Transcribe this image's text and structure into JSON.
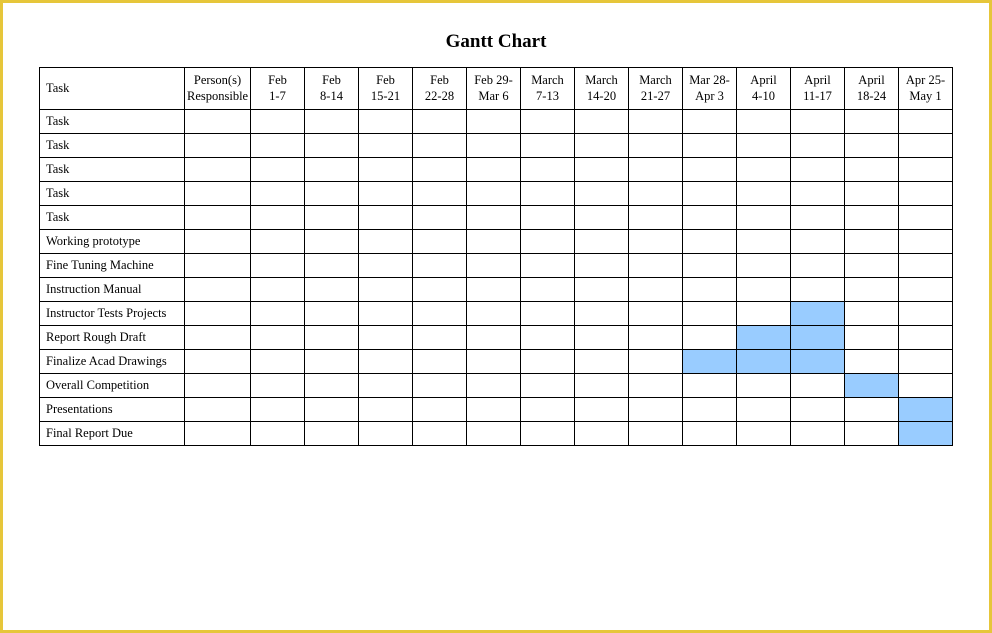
{
  "title": "Gantt Chart",
  "columns": {
    "task": "Task",
    "person": "Person(s) Responsible",
    "dates": [
      "Feb\n1-7",
      "Feb\n8-14",
      "Feb\n15-21",
      "Feb\n22-28",
      "Feb 29-\nMar 6",
      "March\n7-13",
      "March\n14-20",
      "March\n21-27",
      "Mar 28-\nApr 3",
      "April\n4-10",
      "April\n11-17",
      "April\n18-24",
      "Apr 25-\nMay 1"
    ]
  },
  "tasks": [
    {
      "name": "Task",
      "person": "",
      "bars": []
    },
    {
      "name": "Task",
      "person": "",
      "bars": []
    },
    {
      "name": "Task",
      "person": "",
      "bars": []
    },
    {
      "name": "Task",
      "person": "",
      "bars": []
    },
    {
      "name": "Task",
      "person": "",
      "bars": []
    },
    {
      "name": "Working prototype",
      "person": "",
      "bars": []
    },
    {
      "name": "Fine Tuning Machine",
      "person": "",
      "bars": []
    },
    {
      "name": "Instruction Manual",
      "person": "",
      "bars": []
    },
    {
      "name": "Instructor Tests Projects",
      "person": "",
      "bars": [
        10
      ]
    },
    {
      "name": "Report Rough Draft",
      "person": "",
      "bars": [
        9,
        10
      ]
    },
    {
      "name": "Finalize Acad Drawings",
      "person": "",
      "bars": [
        8,
        9,
        10
      ]
    },
    {
      "name": "Overall Competition",
      "person": "",
      "bars": [
        11
      ]
    },
    {
      "name": "Presentations",
      "person": "",
      "bars": [
        12
      ]
    },
    {
      "name": "Final Report Due",
      "person": "",
      "bars": [
        12
      ]
    }
  ],
  "watermark": "",
  "chart_data": {
    "type": "bar",
    "title": "Gantt Chart",
    "xlabel": "",
    "ylabel": "",
    "categories": [
      "Feb 1-7",
      "Feb 8-14",
      "Feb 15-21",
      "Feb 22-28",
      "Feb 29-Mar 6",
      "March 7-13",
      "March 14-20",
      "March 21-27",
      "Mar 28-Apr 3",
      "April 4-10",
      "April 11-17",
      "April 18-24",
      "Apr 25-May 1"
    ],
    "series": [
      {
        "name": "Task",
        "values": [
          0,
          0,
          0,
          0,
          0,
          0,
          0,
          0,
          0,
          0,
          0,
          0,
          0
        ]
      },
      {
        "name": "Task",
        "values": [
          0,
          0,
          0,
          0,
          0,
          0,
          0,
          0,
          0,
          0,
          0,
          0,
          0
        ]
      },
      {
        "name": "Task",
        "values": [
          0,
          0,
          0,
          0,
          0,
          0,
          0,
          0,
          0,
          0,
          0,
          0,
          0
        ]
      },
      {
        "name": "Task",
        "values": [
          0,
          0,
          0,
          0,
          0,
          0,
          0,
          0,
          0,
          0,
          0,
          0,
          0
        ]
      },
      {
        "name": "Task",
        "values": [
          0,
          0,
          0,
          0,
          0,
          0,
          0,
          0,
          0,
          0,
          0,
          0,
          0
        ]
      },
      {
        "name": "Working prototype",
        "values": [
          0,
          0,
          0,
          0,
          0,
          0,
          0,
          0,
          0,
          0,
          0,
          0,
          0
        ]
      },
      {
        "name": "Fine Tuning Machine",
        "values": [
          0,
          0,
          0,
          0,
          0,
          0,
          0,
          0,
          0,
          0,
          0,
          0,
          0
        ]
      },
      {
        "name": "Instruction Manual",
        "values": [
          0,
          0,
          0,
          0,
          0,
          0,
          0,
          0,
          0,
          0,
          0,
          0,
          0
        ]
      },
      {
        "name": "Instructor Tests Projects",
        "values": [
          0,
          0,
          0,
          0,
          0,
          0,
          0,
          0,
          0,
          0,
          1,
          0,
          0
        ]
      },
      {
        "name": "Report Rough Draft",
        "values": [
          0,
          0,
          0,
          0,
          0,
          0,
          0,
          0,
          0,
          1,
          1,
          0,
          0
        ]
      },
      {
        "name": "Finalize Acad Drawings",
        "values": [
          0,
          0,
          0,
          0,
          0,
          0,
          0,
          0,
          1,
          1,
          1,
          0,
          0
        ]
      },
      {
        "name": "Overall Competition",
        "values": [
          0,
          0,
          0,
          0,
          0,
          0,
          0,
          0,
          0,
          0,
          0,
          1,
          0
        ]
      },
      {
        "name": "Presentations",
        "values": [
          0,
          0,
          0,
          0,
          0,
          0,
          0,
          0,
          0,
          0,
          0,
          0,
          1
        ]
      },
      {
        "name": "Final Report Due",
        "values": [
          0,
          0,
          0,
          0,
          0,
          0,
          0,
          0,
          0,
          0,
          0,
          0,
          1
        ]
      }
    ],
    "ylim": [
      0,
      1
    ]
  }
}
